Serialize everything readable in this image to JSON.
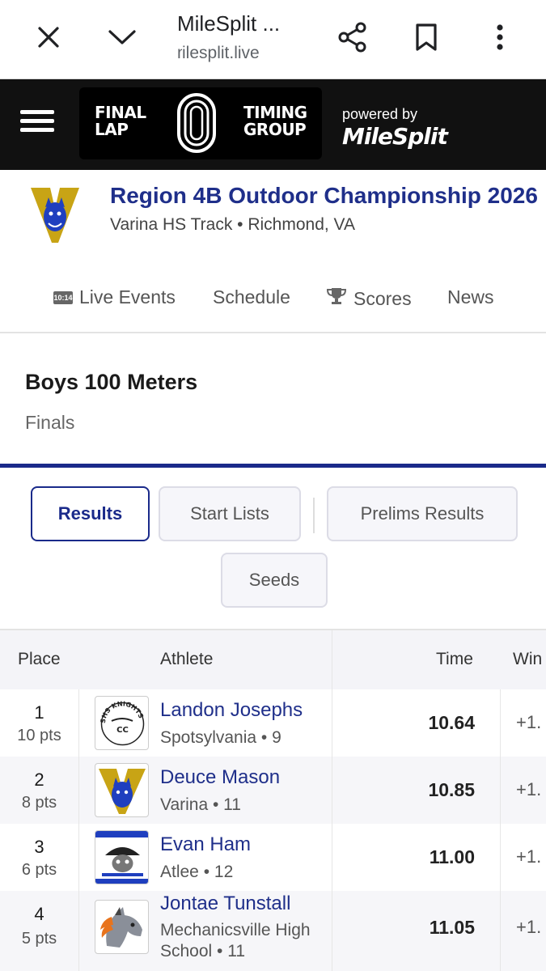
{
  "browser": {
    "title": "MileSplit ...",
    "url": "ilesplit.live"
  },
  "header": {
    "logo_left_line1": "FINAL",
    "logo_left_line2": "LAP",
    "logo_right_line1": "TIMING",
    "logo_right_line2": "GROUP",
    "powered_by": "powered by",
    "brand": "MileSplit"
  },
  "meet": {
    "title": "Region 4B Outdoor Championship 2026",
    "venue": "Varina HS Track • Richmond, VA"
  },
  "nav": {
    "live_events": "Live Events",
    "live_icon_text": "10:14",
    "schedule": "Schedule",
    "scores": "Scores",
    "news": "News"
  },
  "event": {
    "name": "Boys 100 Meters",
    "round": "Finals"
  },
  "tabs": {
    "results": "Results",
    "start_lists": "Start Lists",
    "prelims_results": "Prelims Results",
    "seeds": "Seeds"
  },
  "table": {
    "headers": {
      "place": "Place",
      "athlete": "Athlete",
      "time": "Time",
      "wind": "Win"
    },
    "rows": [
      {
        "place": "1",
        "pts": "10 pts",
        "name": "Landon Josephs",
        "team": "Spotsylvania • 9",
        "time": "10.64",
        "wind": "+1."
      },
      {
        "place": "2",
        "pts": "8 pts",
        "name": "Deuce Mason",
        "team": "Varina • 11",
        "time": "10.85",
        "wind": "+1."
      },
      {
        "place": "3",
        "pts": "6 pts",
        "name": "Evan Ham",
        "team": "Atlee • 12",
        "time": "11.00",
        "wind": "+1."
      },
      {
        "place": "4",
        "pts": "5 pts",
        "name": "Jontae Tunstall",
        "team": "Mechanicsville High School • 11",
        "time": "11.05",
        "wind": "+1."
      }
    ],
    "logo_texts": {
      "spotsy_top": "SHS KNIGHTS",
      "spotsy_center": "CC"
    }
  },
  "colors": {
    "brand_blue": "#1a2a8a",
    "header_bg": "#111111"
  },
  "icons": [
    "close-icon",
    "chevron-down-icon",
    "share-icon",
    "bookmark-icon",
    "more-vert-icon",
    "hamburger-icon",
    "trophy-icon",
    "scoreboard-icon"
  ]
}
